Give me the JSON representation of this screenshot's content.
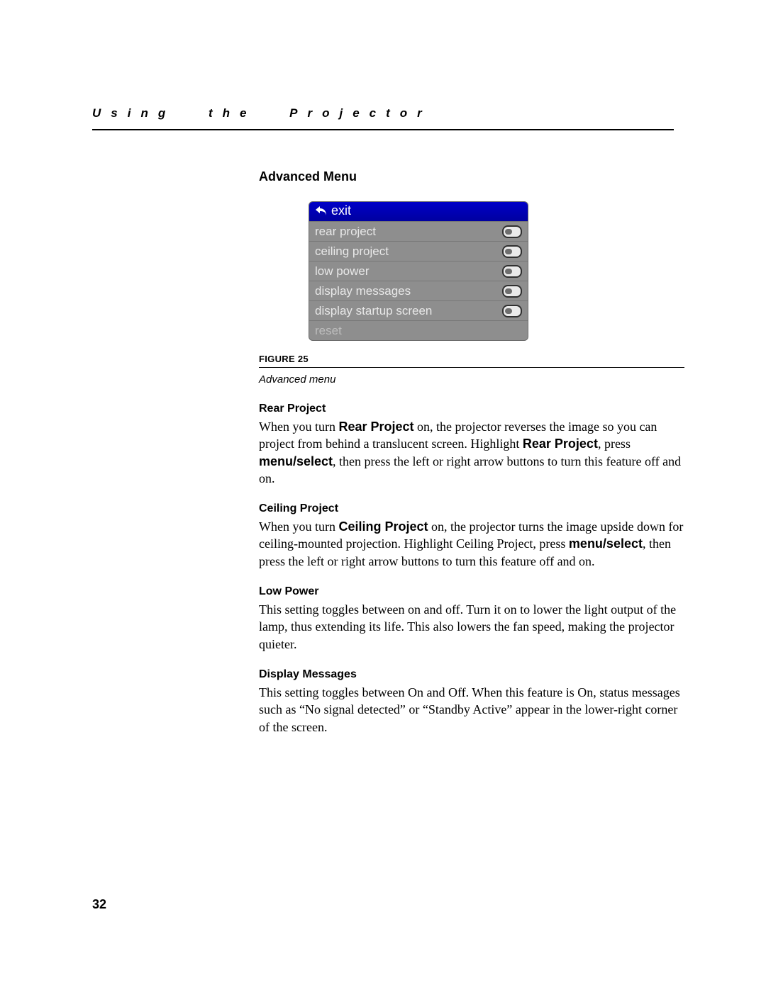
{
  "running_head": "Using the Projector",
  "section_title": "Advanced Menu",
  "menu": {
    "exit": "exit",
    "items": [
      {
        "label": "rear project",
        "toggle": true
      },
      {
        "label": "ceiling project",
        "toggle": true
      },
      {
        "label": "low power",
        "toggle": true
      },
      {
        "label": "display messages",
        "toggle": true
      },
      {
        "label": "display startup screen",
        "toggle": true
      }
    ],
    "reset": "reset"
  },
  "figure_label": "Figure 25",
  "figure_caption": "Advanced menu",
  "sections": {
    "rear_project": {
      "heading": "Rear Project",
      "p1a": "When you turn ",
      "p1b": "Rear Project",
      "p1c": " on, the projector reverses the image so you can project from behind a translucent screen. Highlight ",
      "p1d": "Rear Project",
      "p1e": ", press ",
      "p1f": "menu/select",
      "p1g": ", then press the left or right arrow buttons to turn this feature off and on."
    },
    "ceiling_project": {
      "heading": "Ceiling Project",
      "p1a": "When you turn ",
      "p1b": "Ceiling Project",
      "p1c": " on, the projector turns the image upside down for ceiling-mounted projection. Highlight Ceiling Project, press ",
      "p1d": "menu/select",
      "p1e": ", then press the left or right arrow buttons to turn this feature off and on."
    },
    "low_power": {
      "heading": "Low Power",
      "p1": "This setting toggles between on and off. Turn it on to lower the light output of the lamp, thus extending its life. This also lowers the fan speed, making the projector quieter."
    },
    "display_messages": {
      "heading": "Display Messages",
      "p1": "This setting toggles between On and Off. When this feature is On, status messages such as “No signal detected” or “Standby Active” appear in the lower-right corner of the screen."
    }
  },
  "page_number": "32"
}
